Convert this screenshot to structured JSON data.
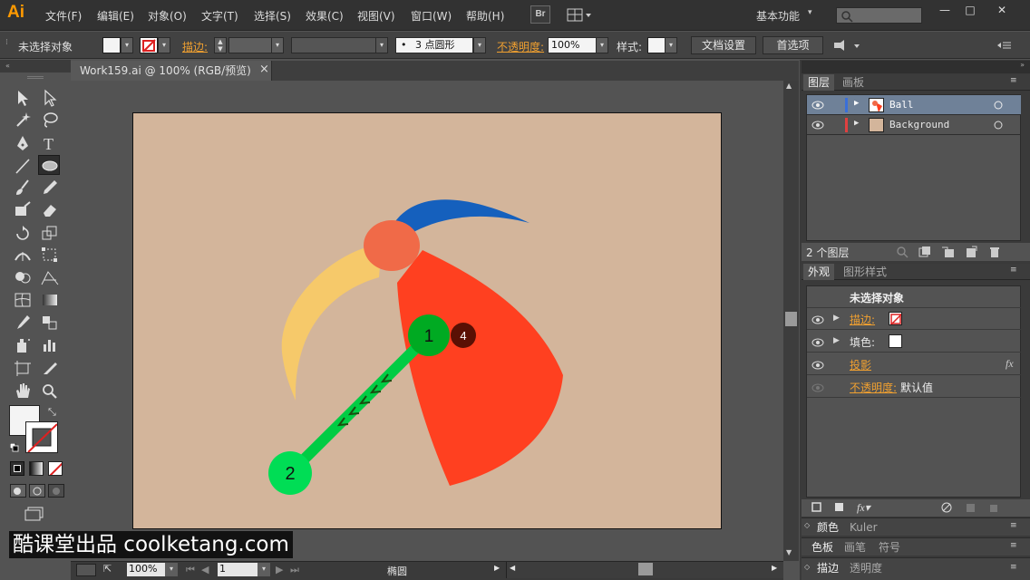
{
  "app": {
    "logo": "Ai",
    "menu": [
      "文件(F)",
      "编辑(E)",
      "对象(O)",
      "文字(T)",
      "选择(S)",
      "效果(C)",
      "视图(V)",
      "窗口(W)",
      "帮助(H)"
    ],
    "bridge_label": "Br",
    "workspace": "基本功能",
    "window_controls": [
      "—",
      "□",
      "✕"
    ]
  },
  "control": {
    "selection_status": "未选择对象",
    "stroke_label": "描边:",
    "brush_value": "3 点圆形",
    "brush_dot": "•",
    "opacity_label": "不透明度:",
    "opacity_value": "100%",
    "style_label": "样式:",
    "doc_setup": "文档设置",
    "preferences": "首选项"
  },
  "document": {
    "tab_title": "Work159.ai @ 100% (RGB/预览)",
    "close": "×"
  },
  "status": {
    "zoom": "100%",
    "page": "1",
    "tool": "椭圆"
  },
  "layers": {
    "tabs": [
      "图层",
      "画板"
    ],
    "rows": [
      {
        "name": "Ball",
        "color": "#3a6fd8"
      },
      {
        "name": "Background",
        "color": "#e04040"
      }
    ],
    "count": "2 个图层"
  },
  "appearance": {
    "tabs": [
      "外观",
      "图形样式"
    ],
    "title": "未选择对象",
    "stroke_label": "描边:",
    "fill_label": "填色:",
    "shadow_label": "投影",
    "opacity_label": "不透明度:",
    "opacity_value": "默认值",
    "fx": "fx"
  },
  "collapsed_panels": [
    {
      "tabs": [
        "颜色",
        "Kuler"
      ]
    },
    {
      "tabs": [
        "色板",
        "画笔",
        "符号"
      ]
    },
    {
      "tabs": [
        "描边",
        "透明度"
      ]
    }
  ],
  "annotations": {
    "step1": "1",
    "step2": "2",
    "step4": "4",
    "arrows": "<<<<<"
  },
  "watermark": "酷课堂出品 coolketang.com",
  "colors": {
    "accent_orange": "#f0a030",
    "artboard": "#d3b59b",
    "red_wedge": "#ff4020",
    "yellow_wing": "#f6c96a",
    "blue_wing": "#1560bd",
    "head": "#f06a48",
    "green_marker": "#00cc44"
  }
}
